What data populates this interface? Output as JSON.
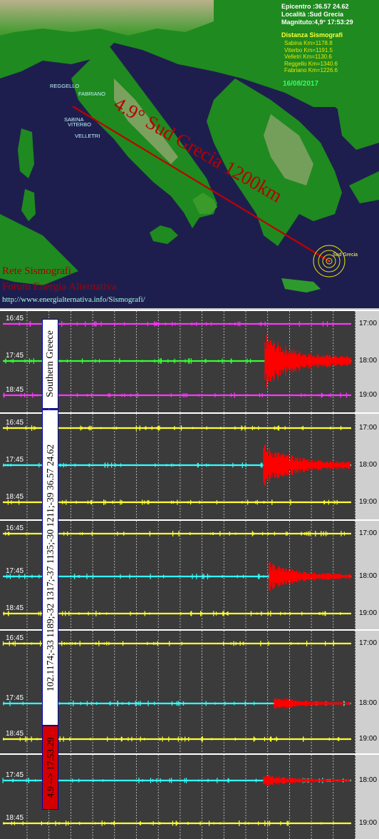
{
  "map": {
    "epicentro": "Epicentro :36.57 24.62",
    "localita": "Località :Sud Grecia",
    "magnituto": "Magnituto:4,9° 17:53:29",
    "distanza_title": "Distanza Sismografi",
    "distances": [
      "Sabina Km=1178.8",
      "Viterbo Km=1191.5",
      "Velletri Km=1130.6",
      "Reggello Km=1340.6",
      "Fabriano Km=1226.6"
    ],
    "date": "16/08/2017",
    "cities": [
      "REGGELLO",
      "FABRIANO",
      "SABINA",
      "VITERBO",
      "VELLETRI"
    ],
    "quake_label": "4.9° Sud Grecia 1200km",
    "epicenter_label": "Sud Grecia",
    "brand_line1": "Rete Sismografi",
    "brand_line2": "Forum Energia Alternativa",
    "brand_url": "http://www.energialternativa.info/Sismografi/",
    "colors": {
      "sea": "#1e1e4e",
      "land": "#1f8a1f",
      "mountain": "#b9b18a",
      "route": "#c00000"
    }
  },
  "panels": [
    {
      "rows": [
        {
          "left": "16:45",
          "right": "17:00",
          "color": "#ff33ff",
          "event": 0
        },
        {
          "left": "17:45",
          "right": "18:00",
          "color": "#33ff33",
          "event": 1
        },
        {
          "left": "18:45",
          "right": "19:00",
          "color": "#ff33ff",
          "event": 0
        }
      ]
    },
    {
      "rows": [
        {
          "left": "16:45",
          "right": "17:00",
          "color": "#ffff33",
          "event": 0
        },
        {
          "left": "17:45",
          "right": "18:00",
          "color": "#33ffff",
          "event": 1
        },
        {
          "left": "18:45",
          "right": "19:00",
          "color": "#ffff33",
          "event": 0
        }
      ]
    },
    {
      "rows": [
        {
          "left": "16:45",
          "right": "17:00",
          "color": "#ffff33",
          "event": 0
        },
        {
          "left": "17:45",
          "right": "18:00",
          "color": "#33ffff",
          "event": 1
        },
        {
          "left": "18:45",
          "right": "19:00",
          "color": "#ffff33",
          "event": 0
        }
      ]
    },
    {
      "rows": [
        {
          "left": "16:45",
          "right": "17:00",
          "color": "#ffff33",
          "event": 0
        },
        {
          "left": "17:45",
          "right": "18:00",
          "color": "#33ffff",
          "event": 1
        },
        {
          "left": "18:45",
          "right": "19:00",
          "color": "#ffff33",
          "event": 0
        }
      ]
    },
    {
      "rows": [
        {
          "left": "17:45",
          "right": "18:00",
          "color": "#33ffff",
          "event": 1
        },
        {
          "left": "18:45",
          "right": "19:00",
          "color": "#ffff33",
          "event": 0
        }
      ]
    }
  ],
  "labels": {
    "region": "Southern Greece",
    "numbers": "102.1174;-33 1189;-32 1317;-37 1135;-30 1211;-39 36.57 24.62",
    "magnitude": "4.9 --> 17:53:29",
    "event_color": "#ff0000"
  }
}
